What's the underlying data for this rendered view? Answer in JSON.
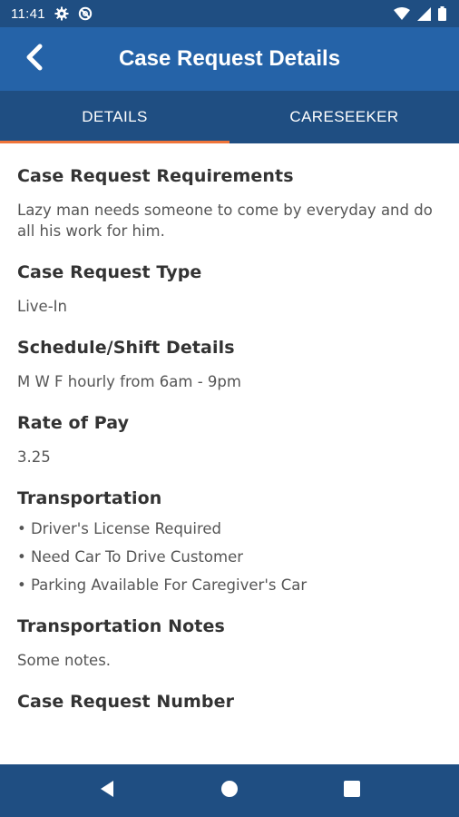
{
  "status_bar": {
    "time": "11:41",
    "icons": [
      "gear-icon",
      "data-saver-icon",
      "wifi-icon",
      "signal-icon",
      "battery-icon"
    ]
  },
  "app_bar": {
    "title": "Case Request Details",
    "back_icon": "chevron-left-icon"
  },
  "tabs": [
    {
      "label": "DETAILS",
      "active": true
    },
    {
      "label": "CARESEEKER",
      "active": false
    }
  ],
  "sections": {
    "requirements": {
      "title": "Case Request Requirements",
      "text": "Lazy man needs someone to come by everyday and do all his work for him."
    },
    "type": {
      "title": "Case Request Type",
      "text": "Live-In"
    },
    "schedule": {
      "title": "Schedule/Shift Details",
      "text": "M W F hourly from 6am - 9pm"
    },
    "rate": {
      "title": "Rate of Pay",
      "text": "3.25"
    },
    "transportation": {
      "title": "Transportation",
      "items": [
        "• Driver's License Required",
        "• Need Car To Drive Customer",
        "• Parking Available For Caregiver's Car"
      ]
    },
    "transportation_notes": {
      "title": "Transportation Notes",
      "text": "Some notes."
    },
    "case_number": {
      "title": "Case Request Number"
    }
  },
  "nav_bar": {
    "icons": [
      "back-triangle-icon",
      "home-circle-icon",
      "recents-square-icon"
    ]
  },
  "colors": {
    "status_bar": "#1f4e82",
    "app_bar": "#2563a8",
    "tab_bar": "#1f4e82",
    "tab_indicator": "#f0753a",
    "nav_bar": "#1f4e82"
  }
}
